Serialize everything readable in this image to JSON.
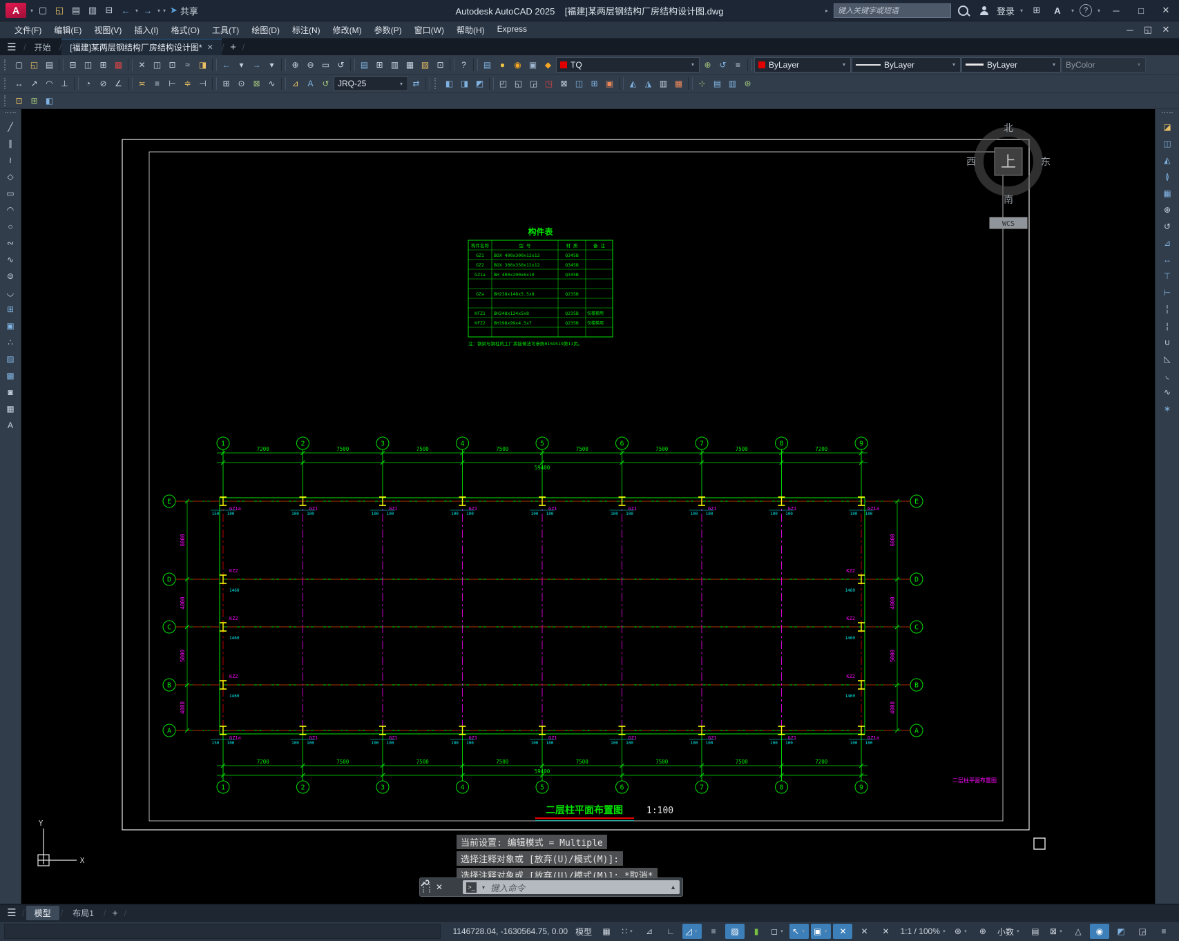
{
  "window": {
    "app_title": "Autodesk AutoCAD 2025",
    "doc_title": "[福建]某两层钢结构厂房结构设计图.dwg",
    "share_label": "共享",
    "search_placeholder": "键入关键字或短语",
    "signin_label": "登录",
    "min": "─",
    "max": "□",
    "close": "✕",
    "restore": "◱"
  },
  "menubar": {
    "items": [
      "文件(F)",
      "编辑(E)",
      "视图(V)",
      "插入(I)",
      "格式(O)",
      "工具(T)",
      "绘图(D)",
      "标注(N)",
      "修改(M)",
      "参数(P)",
      "窗口(W)",
      "帮助(H)",
      "Express"
    ]
  },
  "filetabs": {
    "start": "开始",
    "doc": "[福建]某两层钢结构厂房结构设计图*",
    "close": "✕",
    "add": "+"
  },
  "toolbars": {
    "dim_style": "JRQ-25",
    "layer_name": "TQ",
    "color": "ByLayer",
    "linetype": "ByLayer",
    "lineweight": "ByLayer",
    "plot_style": "ByColor",
    "row1": [
      {
        "n": "new-file-icon",
        "g": "▢"
      },
      {
        "n": "open-file-icon",
        "g": "◱",
        "c": "#e8c063"
      },
      {
        "n": "save-file-icon",
        "g": "▤"
      },
      {
        "n": "sep"
      },
      {
        "n": "print-icon",
        "g": "⊟"
      },
      {
        "n": "print-preview-icon",
        "g": "◫"
      },
      {
        "n": "batch-plot-icon",
        "g": "⊞"
      },
      {
        "n": "export-dwf-icon",
        "g": "▦",
        "c": "#d84545"
      },
      {
        "n": "sep"
      },
      {
        "n": "cut-icon",
        "g": "✕"
      },
      {
        "n": "copy-clip-icon",
        "g": "◫"
      },
      {
        "n": "paste-icon",
        "g": "⊡"
      },
      {
        "n": "match-properties-icon",
        "g": "≈"
      },
      {
        "n": "erase-markup-icon",
        "g": "◨",
        "c": "#e8c063"
      },
      {
        "n": "sep"
      },
      {
        "n": "undo-icon",
        "g": "←",
        "c": "#7fb2e0"
      },
      {
        "n": "undo-caret-icon",
        "g": "▾"
      },
      {
        "n": "redo-icon",
        "g": "→",
        "c": "#7fb2e0"
      },
      {
        "n": "redo-caret-icon",
        "g": "▾"
      },
      {
        "n": "sep"
      },
      {
        "n": "pan-icon",
        "g": "⊕"
      },
      {
        "n": "zoom-realtime-icon",
        "g": "⊖"
      },
      {
        "n": "zoom-window-icon",
        "g": "▭"
      },
      {
        "n": "zoom-previous-icon",
        "g": "↺"
      },
      {
        "n": "sep"
      },
      {
        "n": "properties-palette-icon",
        "g": "▤",
        "c": "#7fb2e0"
      },
      {
        "n": "designcenter-icon",
        "g": "⊞"
      },
      {
        "n": "tool-palettes-icon",
        "g": "▥"
      },
      {
        "n": "sheet-set-icon",
        "g": "▦"
      },
      {
        "n": "markup-import-icon",
        "g": "▧",
        "c": "#e8c063"
      },
      {
        "n": "quickcalc-icon",
        "g": "⊡"
      },
      {
        "n": "sep"
      },
      {
        "n": "help-icon",
        "g": "?"
      }
    ],
    "layer_cluster": [
      {
        "n": "layer-properties-icon",
        "g": "▤",
        "c": "#7fb2e0"
      },
      {
        "n": "layer-on-bulb-icon",
        "g": "●",
        "c": "#f5c542"
      },
      {
        "n": "layer-thaw-sun-icon",
        "g": "◉",
        "c": "#f5a623"
      },
      {
        "n": "layer-vp-freeze-icon",
        "g": "▣",
        "c": "#9fb6ce"
      },
      {
        "n": "layer-unlock-icon",
        "g": "◆",
        "c": "#f5a623"
      }
    ],
    "layer_tools": [
      {
        "n": "make-object-layer-current-icon",
        "g": "⊕",
        "c": "#9fc27a"
      },
      {
        "n": "layer-previous-icon",
        "g": "↺",
        "c": "#7fb2e0"
      },
      {
        "n": "layer-states-icon",
        "g": "≡"
      }
    ],
    "row2": [
      {
        "n": "linear-dim-icon",
        "g": "↔"
      },
      {
        "n": "aligned-dim-icon",
        "g": "↗"
      },
      {
        "n": "arc-length-dim-icon",
        "g": "◠"
      },
      {
        "n": "ordinate-dim-icon",
        "g": "⊥"
      },
      {
        "n": "sep"
      },
      {
        "n": "radius-dim-icon",
        "g": "◔"
      },
      {
        "n": "diameter-dim-icon",
        "g": "⊘"
      },
      {
        "n": "angular-dim-icon",
        "g": "∠"
      },
      {
        "n": "sep"
      },
      {
        "n": "quick-dim-icon",
        "g": "≍",
        "c": "#e8c063"
      },
      {
        "n": "baseline-dim-icon",
        "g": "≡"
      },
      {
        "n": "continue-dim-icon",
        "g": "⊢"
      },
      {
        "n": "dim-space-icon",
        "g": "≑",
        "c": "#e8c063"
      },
      {
        "n": "dim-break-icon",
        "g": "⊣"
      },
      {
        "n": "sep"
      },
      {
        "n": "tolerance-icon",
        "g": "⊞"
      },
      {
        "n": "center-mark-icon",
        "g": "⊙"
      },
      {
        "n": "dim-inspect-icon",
        "g": "⊠",
        "c": "#9fc27a"
      },
      {
        "n": "dim-jogged-icon",
        "g": "∿"
      },
      {
        "n": "sep"
      },
      {
        "n": "dim-edit-icon",
        "g": "⊿",
        "c": "#e8c063"
      },
      {
        "n": "dim-text-edit-icon",
        "g": "A",
        "c": "#7fb2e0"
      },
      {
        "n": "dim-update-icon",
        "g": "↺",
        "c": "#9fc27a"
      }
    ],
    "row2_right": [
      {
        "n": "make-block-icon",
        "g": "◧",
        "c": "#7fb2e0"
      },
      {
        "n": "insert-block-icon",
        "g": "◨",
        "c": "#7fb2e0"
      },
      {
        "n": "block-editor-icon",
        "g": "◩",
        "c": "#7fb2e0"
      },
      {
        "n": "sep"
      },
      {
        "n": "base-point-icon",
        "g": "◰"
      },
      {
        "n": "move-block-icon",
        "g": "◱"
      },
      {
        "n": "copy-block-icon",
        "g": "◲"
      },
      {
        "n": "delete-block-icon",
        "g": "◳",
        "c": "#d84545"
      },
      {
        "n": "rotate-block-icon",
        "g": "⊠"
      },
      {
        "n": "flip-block-icon",
        "g": "◫",
        "c": "#7fb2e0"
      },
      {
        "n": "array-block-icon",
        "g": "⊞",
        "c": "#7fb2e0"
      },
      {
        "n": "align-block-icon",
        "g": "▣",
        "c": "#e8885a"
      },
      {
        "n": "sep"
      },
      {
        "n": "wipeout-icon",
        "g": "◭",
        "c": "#7fb2e0"
      },
      {
        "n": "revcloud-tool-icon",
        "g": "◮",
        "c": "#7fb2e0"
      },
      {
        "n": "boundary-icon",
        "g": "▥"
      },
      {
        "n": "group-icon",
        "g": "▦",
        "c": "#e8885a"
      },
      {
        "n": "sep"
      },
      {
        "n": "ucs-icon-btn",
        "g": "⊹",
        "c": "#9fc27a"
      },
      {
        "n": "named-views-icon",
        "g": "▤",
        "c": "#7fb2e0"
      },
      {
        "n": "viewport-icon",
        "g": "▥",
        "c": "#7fb2e0"
      },
      {
        "n": "render-icon",
        "g": "⊛",
        "c": "#9fc27a"
      }
    ],
    "row3": [
      {
        "n": "draworder-front-icon",
        "g": "⊡",
        "c": "#e8c063"
      },
      {
        "n": "draworder-back-icon",
        "g": "⊞",
        "c": "#9fc27a"
      },
      {
        "n": "annotation-scale-tool-icon",
        "g": "◧",
        "c": "#7fb2e0"
      }
    ],
    "draw_bar": [
      {
        "n": "line-tool-icon",
        "g": "╱"
      },
      {
        "n": "xline-tool-icon",
        "g": "∥"
      },
      {
        "n": "polyline-tool-icon",
        "g": "≀"
      },
      {
        "n": "polygon-tool-icon",
        "g": "◇"
      },
      {
        "n": "rectangle-tool-icon",
        "g": "▭"
      },
      {
        "n": "arc-tool-icon",
        "g": "◠"
      },
      {
        "n": "circle-tool-icon",
        "g": "○"
      },
      {
        "n": "revcloud-icon",
        "g": "∾"
      },
      {
        "n": "spline-tool-icon",
        "g": "∿"
      },
      {
        "n": "ellipse-tool-icon",
        "g": "⊜"
      },
      {
        "n": "ellipse-arc-icon",
        "g": "◡"
      },
      {
        "n": "insert-block-tool-icon",
        "g": "⊞",
        "c": "#7fb2e0"
      },
      {
        "n": "make-block-tool-icon",
        "g": "▣",
        "c": "#7fb2e0"
      },
      {
        "n": "point-tool-icon",
        "g": "∴"
      },
      {
        "n": "hatch-tool-icon",
        "g": "▨",
        "c": "#7fb2e0"
      },
      {
        "n": "gradient-tool-icon",
        "g": "▩",
        "c": "#7fb2e0"
      },
      {
        "n": "region-tool-icon",
        "g": "◙"
      },
      {
        "n": "table-tool-icon",
        "g": "▦"
      },
      {
        "n": "mtext-tool-icon",
        "g": "A"
      }
    ],
    "modify_bar": [
      {
        "n": "erase-tool-icon",
        "g": "◪",
        "c": "#e8c063"
      },
      {
        "n": "copy-tool-icon",
        "g": "◫",
        "c": "#7fb2e0"
      },
      {
        "n": "mirror-tool-icon",
        "g": "◭",
        "c": "#7fb2e0"
      },
      {
        "n": "offset-tool-icon",
        "g": "≬",
        "c": "#7fb2e0"
      },
      {
        "n": "array-tool-icon",
        "g": "▦",
        "c": "#7fb2e0"
      },
      {
        "n": "move-tool-icon",
        "g": "⊕"
      },
      {
        "n": "rotate-tool-icon",
        "g": "↺"
      },
      {
        "n": "scale-tool-icon",
        "g": "⊿",
        "c": "#7fb2e0"
      },
      {
        "n": "stretch-tool-icon",
        "g": "↔",
        "c": "#7fb2e0"
      },
      {
        "n": "trim-tool-icon",
        "g": "⊤",
        "c": "#7fb2e0"
      },
      {
        "n": "extend-tool-icon",
        "g": "⊢",
        "c": "#7fb2e0"
      },
      {
        "n": "break-at-point-icon",
        "g": "╎"
      },
      {
        "n": "break-tool-icon",
        "g": "¦"
      },
      {
        "n": "join-tool-icon",
        "g": "∪"
      },
      {
        "n": "chamfer-tool-icon",
        "g": "◺"
      },
      {
        "n": "fillet-tool-icon",
        "g": "◟"
      },
      {
        "n": "blend-tool-icon",
        "g": "∿"
      },
      {
        "n": "explode-tool-icon",
        "g": "∗",
        "c": "#7fb2e0"
      }
    ]
  },
  "compass": {
    "north": "北",
    "south": "南",
    "east": "东",
    "west": "西",
    "up": "上",
    "wcs": "WCS"
  },
  "component_table": {
    "title": "构件表",
    "headers": [
      "构件名称",
      "型  号",
      "材 质",
      "备 注"
    ],
    "rows": [
      [
        "GZ1",
        "BOX 400x300x12x12",
        "Q345B",
        ""
      ],
      [
        "GZ2",
        "BOX 300x350x12x12",
        "Q345B",
        ""
      ],
      [
        "GZ1a",
        "BH 400x200x6x10",
        "Q345B",
        ""
      ],
      [
        "",
        "",
        "",
        ""
      ],
      [
        "GZa",
        "BH238x148x5.5x8",
        "Q235B",
        ""
      ],
      [
        "",
        "",
        "",
        ""
      ],
      [
        "KFZ1",
        "BH248x124x5x8",
        "Q235B",
        "仅楼梯用"
      ],
      [
        "KFZ2",
        "BH198x99x4.5x7",
        "Q235B",
        "仅楼梯用"
      ],
      [
        "",
        "",
        "",
        ""
      ]
    ],
    "note": "注：钢梁与钢柱的工厂拼接做法可参照01SG519第11页。"
  },
  "plan": {
    "title": "二层柱平面布置图",
    "scale": "1:100",
    "side_note": "二层柱平面布置图",
    "h_grids": [
      "1",
      "2",
      "3",
      "4",
      "5",
      "6",
      "7",
      "8",
      "9"
    ],
    "v_grids": [
      "E",
      "D",
      "C",
      "B",
      "A"
    ],
    "bay_dims": [
      "7200",
      "7500",
      "7500",
      "7500",
      "7500",
      "7500",
      "7500",
      "7200"
    ],
    "total_dim": "59400",
    "row_dims": [
      "6000",
      "4000",
      "5000",
      "4000"
    ],
    "col_label_edge": "GZ1a",
    "col_label_mid": "GZ1",
    "col_label_side": "KZ2",
    "col_dims": [
      "150",
      "100"
    ],
    "side_col_dim": "1460"
  },
  "command": {
    "history": [
      "当前设置: 编辑模式 = Multiple",
      "选择注释对象或 [放弃(U)/模式(M)]:",
      "选择注释对象或 [放弃(U)/模式(M)]: *取消*"
    ],
    "placeholder": "键入命令"
  },
  "model_tabs": {
    "model": "模型",
    "layout1": "布局1",
    "add": "+"
  },
  "statusbar": {
    "items": [
      {
        "n": "coordinates-display",
        "t": "1146728.04, -1630564.75, 0.00"
      },
      {
        "n": "model-space-button",
        "t": "模型"
      },
      {
        "n": "grid-display-icon",
        "g": "▦"
      },
      {
        "n": "snap-mode-icon",
        "g": "∷",
        "caret": true
      },
      {
        "n": "infer-constraints-icon",
        "g": "⊿"
      },
      {
        "n": "ortho-mode-icon",
        "g": "∟"
      },
      {
        "n": "polar-tracking-icon",
        "g": "◿",
        "hl": true,
        "caret": true
      },
      {
        "n": "lineweight-display-icon",
        "g": "≡"
      },
      {
        "n": "transparency-icon",
        "g": "▨",
        "hl": true
      },
      {
        "n": "selection-cycling-icon",
        "g": "▮",
        "c": "#7ac143"
      },
      {
        "n": "isodraft-icon",
        "g": "◻",
        "caret": true
      },
      {
        "n": "autosnap-tracking-icon",
        "g": "↖",
        "hl": true,
        "caret": true
      },
      {
        "n": "object-snap-icon",
        "g": "▣",
        "hl": true,
        "caret": true
      },
      {
        "n": "annotation-visibility-icon",
        "g": "✕",
        "hl": true
      },
      {
        "n": "annotation-autoscale-icon",
        "g": "✕"
      },
      {
        "n": "annotation-objects-icon",
        "g": "✕"
      },
      {
        "n": "annotation-scale-button",
        "t": "1:1 / 100%",
        "caret": true
      },
      {
        "n": "workspace-switching-icon",
        "g": "⊛",
        "caret": true
      },
      {
        "n": "annotation-monitor-icon",
        "g": "⊕"
      },
      {
        "n": "units-button",
        "t": "小数",
        "caret": true
      },
      {
        "n": "quick-properties-icon",
        "g": "▤"
      },
      {
        "n": "lock-ui-icon",
        "g": "⊠",
        "caret": true
      },
      {
        "n": "isolate-objects-icon",
        "g": "△"
      },
      {
        "n": "graphics-performance-icon",
        "g": "◉",
        "hl": true
      },
      {
        "n": "clean-screen-icon",
        "g": "◩",
        "c": "#7fb2e0"
      },
      {
        "n": "fullscreen-icon",
        "g": "◲"
      },
      {
        "n": "customization-menu-icon",
        "g": "≡"
      }
    ]
  },
  "colors": {
    "cad_green": "#00e500",
    "cad_red": "#e80000",
    "cad_magenta": "#ff00ff",
    "cad_cyan": "#00e5e5",
    "cad_yellow": "#ffff00",
    "frame_white": "#e8e8e8",
    "accent_blue": "#3d7fb8"
  }
}
